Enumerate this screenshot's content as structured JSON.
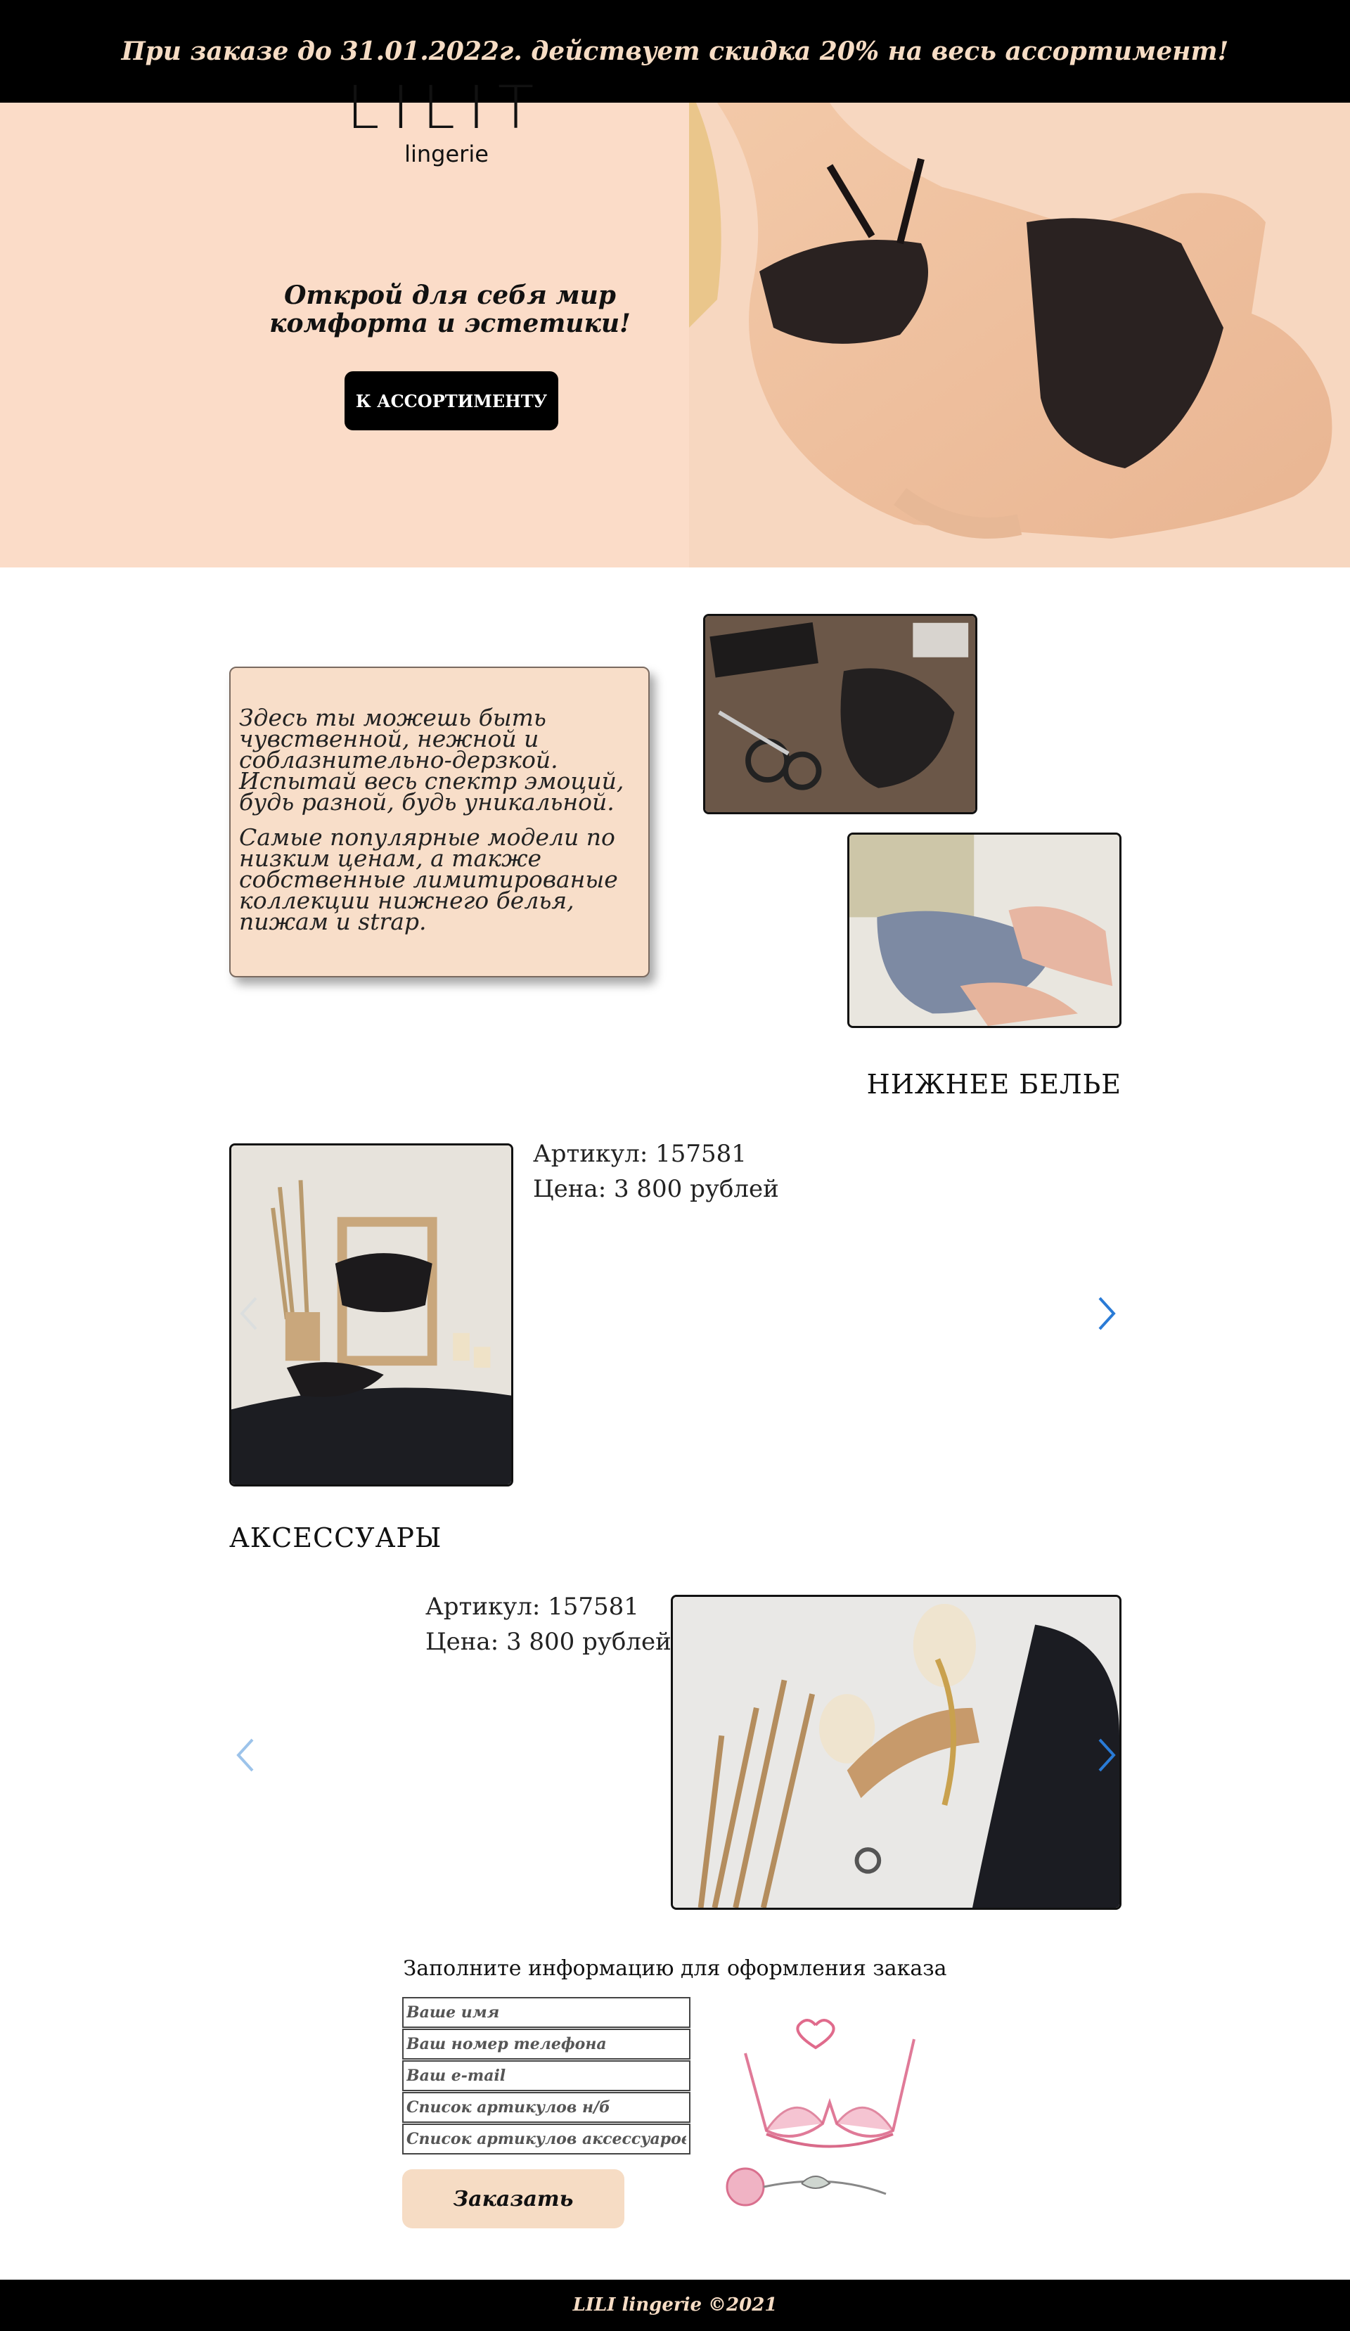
{
  "promo": {
    "text": "При заказе до 31.01.2022г. действует скидка 20% на весь ассортимент!"
  },
  "hero": {
    "logo_main": "LILIT",
    "logo_sub": "lingerie",
    "tagline": "Открой для себя мир комфорта и эстетики!",
    "cta_label": "К АССОРТИМЕНТУ"
  },
  "intro": {
    "paragraph1": "Здесь ты можешь быть чувственной, нежной и соблазнительно-дерзкой. Испытай весь спектр эмоций, будь разной, будь уникальной.",
    "paragraph2": "Самые популярные модели по низким ценам, а также собственные лимитированые коллекции нижнего белья, пижам и strap."
  },
  "lingerie": {
    "title": "НИЖНЕЕ БЕЛЬЕ",
    "article": "Артикул: 157581",
    "price": "Цена: 3 800 рублей"
  },
  "accessories": {
    "title": "АКСЕССУАРЫ",
    "article": "Артикул: 157581",
    "price": "Цена: 3 800 рублей"
  },
  "order_form": {
    "title": "Заполните информацию для оформления заказа",
    "name_placeholder": "Ваше имя",
    "phone_placeholder": "Ваш номер телефона",
    "email_placeholder": "Ваш e-mail",
    "lingerie_placeholder": "Список артикулов н/б",
    "accessories_placeholder": "Список артикулов аксессуаров",
    "submit_label": "Заказать"
  },
  "footer": {
    "text": "LILI lingerie ©2021"
  },
  "colors": {
    "peach": "#fbdcc8",
    "beige": "#f6dcc4",
    "black": "#000000",
    "arrow_blue": "#2a7bd6",
    "arrow_light": "#9cc3ea"
  },
  "icons": {
    "carousel_next": "chevron-right-icon",
    "carousel_prev": "chevron-left-icon"
  }
}
